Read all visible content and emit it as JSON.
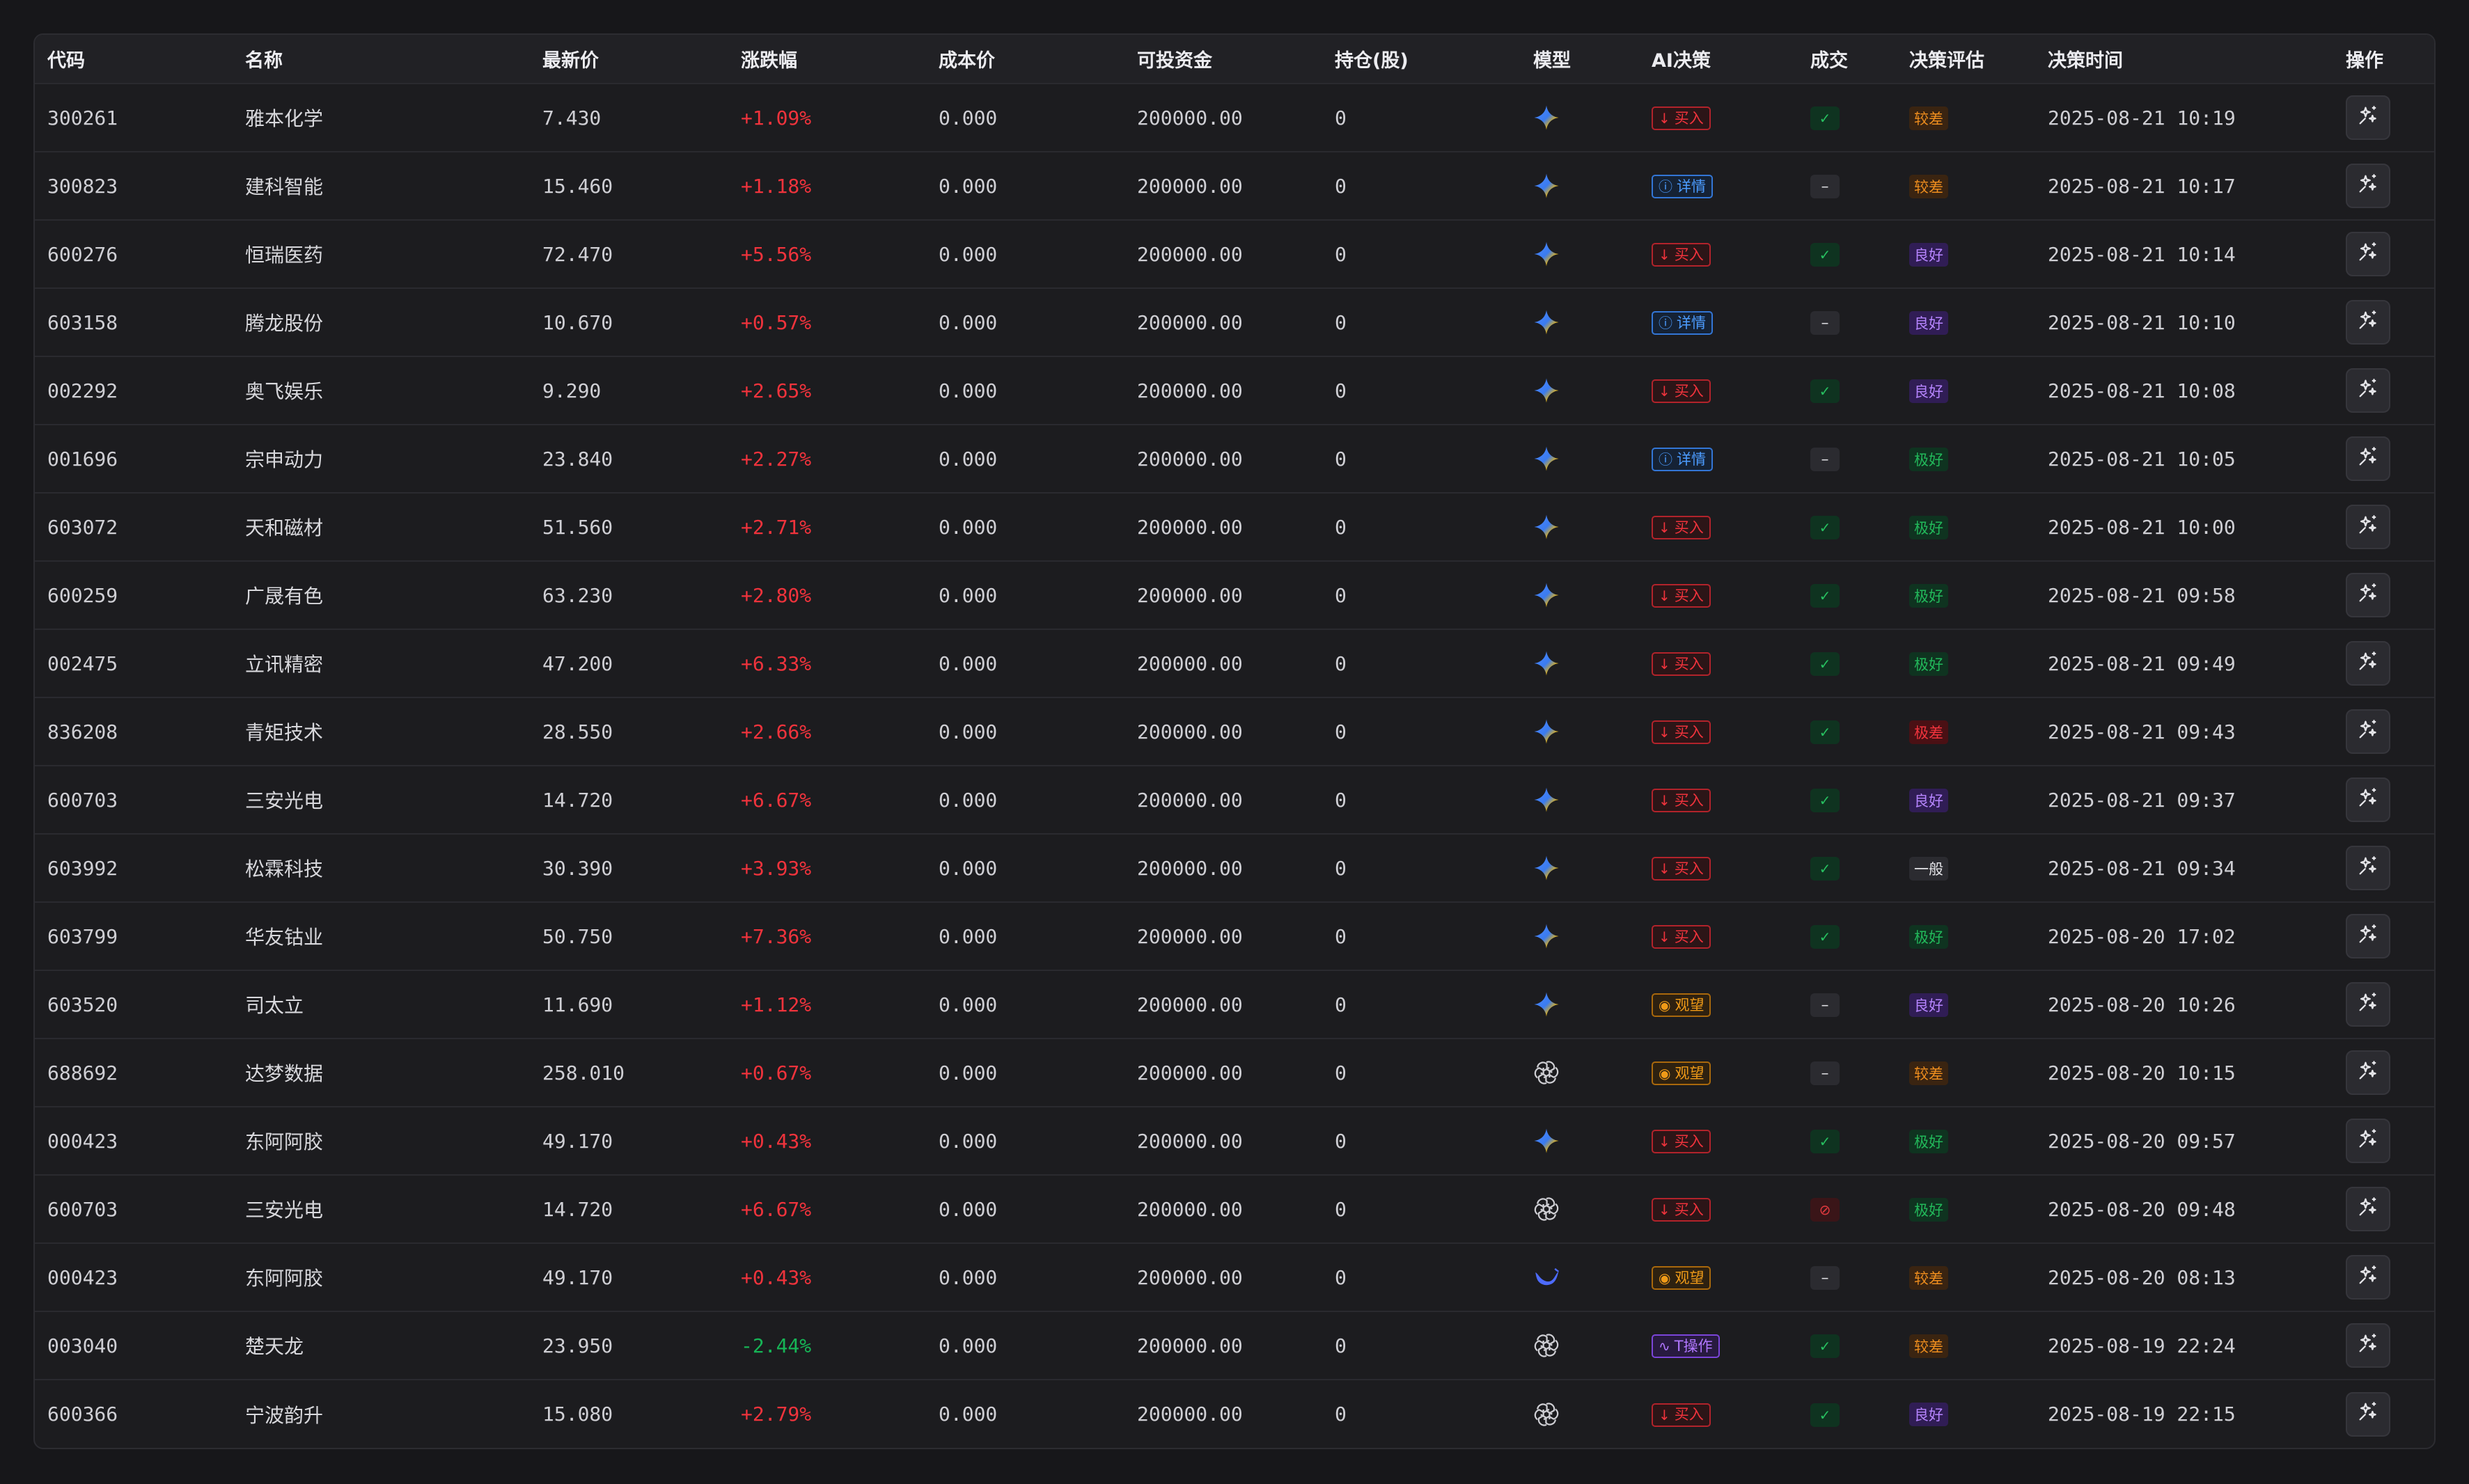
{
  "columns": [
    "代码",
    "名称",
    "最新价",
    "涨跌幅",
    "成本价",
    "可投资金",
    "持仓(股)",
    "模型",
    "AI决策",
    "成交",
    "决策评估",
    "决策时间",
    "操作"
  ],
  "colors": {
    "up": "#f0333c",
    "down": "#16b556",
    "background": "#17171a",
    "panel": "#1c1c1f"
  },
  "rows": [
    {
      "code": "300261",
      "name": "雅本化学",
      "price": "7.430",
      "change": "+1.09%",
      "dir": "up",
      "cost": "0.000",
      "funds": "200000.00",
      "hold": "0",
      "model": "gemini",
      "decision": "buy",
      "decision_label": "买入",
      "deal": "ok",
      "eval": "较差",
      "eval_type": "bad",
      "time": "2025-08-21 10:19"
    },
    {
      "code": "300823",
      "name": "建科智能",
      "price": "15.460",
      "change": "+1.18%",
      "dir": "up",
      "cost": "0.000",
      "funds": "200000.00",
      "hold": "0",
      "model": "gemini",
      "decision": "info",
      "decision_label": "详情",
      "deal": "dash",
      "eval": "较差",
      "eval_type": "bad",
      "time": "2025-08-21 10:17"
    },
    {
      "code": "600276",
      "name": "恒瑞医药",
      "price": "72.470",
      "change": "+5.56%",
      "dir": "up",
      "cost": "0.000",
      "funds": "200000.00",
      "hold": "0",
      "model": "gemini",
      "decision": "buy",
      "decision_label": "买入",
      "deal": "ok",
      "eval": "良好",
      "eval_type": "good",
      "time": "2025-08-21 10:14"
    },
    {
      "code": "603158",
      "name": "腾龙股份",
      "price": "10.670",
      "change": "+0.57%",
      "dir": "up",
      "cost": "0.000",
      "funds": "200000.00",
      "hold": "0",
      "model": "gemini",
      "decision": "info",
      "decision_label": "详情",
      "deal": "dash",
      "eval": "良好",
      "eval_type": "good",
      "time": "2025-08-21 10:10"
    },
    {
      "code": "002292",
      "name": "奥飞娱乐",
      "price": "9.290",
      "change": "+2.65%",
      "dir": "up",
      "cost": "0.000",
      "funds": "200000.00",
      "hold": "0",
      "model": "gemini",
      "decision": "buy",
      "decision_label": "买入",
      "deal": "ok",
      "eval": "良好",
      "eval_type": "good",
      "time": "2025-08-21 10:08"
    },
    {
      "code": "001696",
      "name": "宗申动力",
      "price": "23.840",
      "change": "+2.27%",
      "dir": "up",
      "cost": "0.000",
      "funds": "200000.00",
      "hold": "0",
      "model": "gemini",
      "decision": "info",
      "decision_label": "详情",
      "deal": "dash",
      "eval": "极好",
      "eval_type": "great",
      "time": "2025-08-21 10:05"
    },
    {
      "code": "603072",
      "name": "天和磁材",
      "price": "51.560",
      "change": "+2.71%",
      "dir": "up",
      "cost": "0.000",
      "funds": "200000.00",
      "hold": "0",
      "model": "gemini",
      "decision": "buy",
      "decision_label": "买入",
      "deal": "ok",
      "eval": "极好",
      "eval_type": "great",
      "time": "2025-08-21 10:00"
    },
    {
      "code": "600259",
      "name": "广晟有色",
      "price": "63.230",
      "change": "+2.80%",
      "dir": "up",
      "cost": "0.000",
      "funds": "200000.00",
      "hold": "0",
      "model": "gemini",
      "decision": "buy",
      "decision_label": "买入",
      "deal": "ok",
      "eval": "极好",
      "eval_type": "great",
      "time": "2025-08-21 09:58"
    },
    {
      "code": "002475",
      "name": "立讯精密",
      "price": "47.200",
      "change": "+6.33%",
      "dir": "up",
      "cost": "0.000",
      "funds": "200000.00",
      "hold": "0",
      "model": "gemini",
      "decision": "buy",
      "decision_label": "买入",
      "deal": "ok",
      "eval": "极好",
      "eval_type": "great",
      "time": "2025-08-21 09:49"
    },
    {
      "code": "836208",
      "name": "青矩技术",
      "price": "28.550",
      "change": "+2.66%",
      "dir": "up",
      "cost": "0.000",
      "funds": "200000.00",
      "hold": "0",
      "model": "gemini",
      "decision": "buy",
      "decision_label": "买入",
      "deal": "ok",
      "eval": "极差",
      "eval_type": "worst",
      "time": "2025-08-21 09:43"
    },
    {
      "code": "600703",
      "name": "三安光电",
      "price": "14.720",
      "change": "+6.67%",
      "dir": "up",
      "cost": "0.000",
      "funds": "200000.00",
      "hold": "0",
      "model": "gemini",
      "decision": "buy",
      "decision_label": "买入",
      "deal": "ok",
      "eval": "良好",
      "eval_type": "good",
      "time": "2025-08-21 09:37"
    },
    {
      "code": "603992",
      "name": "松霖科技",
      "price": "30.390",
      "change": "+3.93%",
      "dir": "up",
      "cost": "0.000",
      "funds": "200000.00",
      "hold": "0",
      "model": "gemini",
      "decision": "buy",
      "decision_label": "买入",
      "deal": "ok",
      "eval": "一般",
      "eval_type": "mid",
      "time": "2025-08-21 09:34"
    },
    {
      "code": "603799",
      "name": "华友钴业",
      "price": "50.750",
      "change": "+7.36%",
      "dir": "up",
      "cost": "0.000",
      "funds": "200000.00",
      "hold": "0",
      "model": "gemini",
      "decision": "buy",
      "decision_label": "买入",
      "deal": "ok",
      "eval": "极好",
      "eval_type": "great",
      "time": "2025-08-20 17:02"
    },
    {
      "code": "603520",
      "name": "司太立",
      "price": "11.690",
      "change": "+1.12%",
      "dir": "up",
      "cost": "0.000",
      "funds": "200000.00",
      "hold": "0",
      "model": "gemini",
      "decision": "watch",
      "decision_label": "观望",
      "deal": "dash",
      "eval": "良好",
      "eval_type": "good",
      "time": "2025-08-20 10:26"
    },
    {
      "code": "688692",
      "name": "达梦数据",
      "price": "258.010",
      "change": "+0.67%",
      "dir": "up",
      "cost": "0.000",
      "funds": "200000.00",
      "hold": "0",
      "model": "openai",
      "decision": "watch",
      "decision_label": "观望",
      "deal": "dash",
      "eval": "较差",
      "eval_type": "bad",
      "time": "2025-08-20 10:15"
    },
    {
      "code": "000423",
      "name": "东阿阿胶",
      "price": "49.170",
      "change": "+0.43%",
      "dir": "up",
      "cost": "0.000",
      "funds": "200000.00",
      "hold": "0",
      "model": "gemini",
      "decision": "buy",
      "decision_label": "买入",
      "deal": "ok",
      "eval": "极好",
      "eval_type": "great",
      "time": "2025-08-20 09:57"
    },
    {
      "code": "600703",
      "name": "三安光电",
      "price": "14.720",
      "change": "+6.67%",
      "dir": "up",
      "cost": "0.000",
      "funds": "200000.00",
      "hold": "0",
      "model": "openai",
      "decision": "buy",
      "decision_label": "买入",
      "deal": "no",
      "eval": "极好",
      "eval_type": "great",
      "time": "2025-08-20 09:48"
    },
    {
      "code": "000423",
      "name": "东阿阿胶",
      "price": "49.170",
      "change": "+0.43%",
      "dir": "up",
      "cost": "0.000",
      "funds": "200000.00",
      "hold": "0",
      "model": "deepseek",
      "decision": "watch",
      "decision_label": "观望",
      "deal": "dash",
      "eval": "较差",
      "eval_type": "bad",
      "time": "2025-08-20 08:13"
    },
    {
      "code": "003040",
      "name": "楚天龙",
      "price": "23.950",
      "change": "-2.44%",
      "dir": "down",
      "cost": "0.000",
      "funds": "200000.00",
      "hold": "0",
      "model": "openai",
      "decision": "t",
      "decision_label": "T操作",
      "deal": "ok",
      "eval": "较差",
      "eval_type": "bad",
      "time": "2025-08-19 22:24"
    },
    {
      "code": "600366",
      "name": "宁波韵升",
      "price": "15.080",
      "change": "+2.79%",
      "dir": "up",
      "cost": "0.000",
      "funds": "200000.00",
      "hold": "0",
      "model": "openai",
      "decision": "buy",
      "decision_label": "买入",
      "deal": "ok",
      "eval": "良好",
      "eval_type": "good",
      "time": "2025-08-19 22:15"
    }
  ]
}
